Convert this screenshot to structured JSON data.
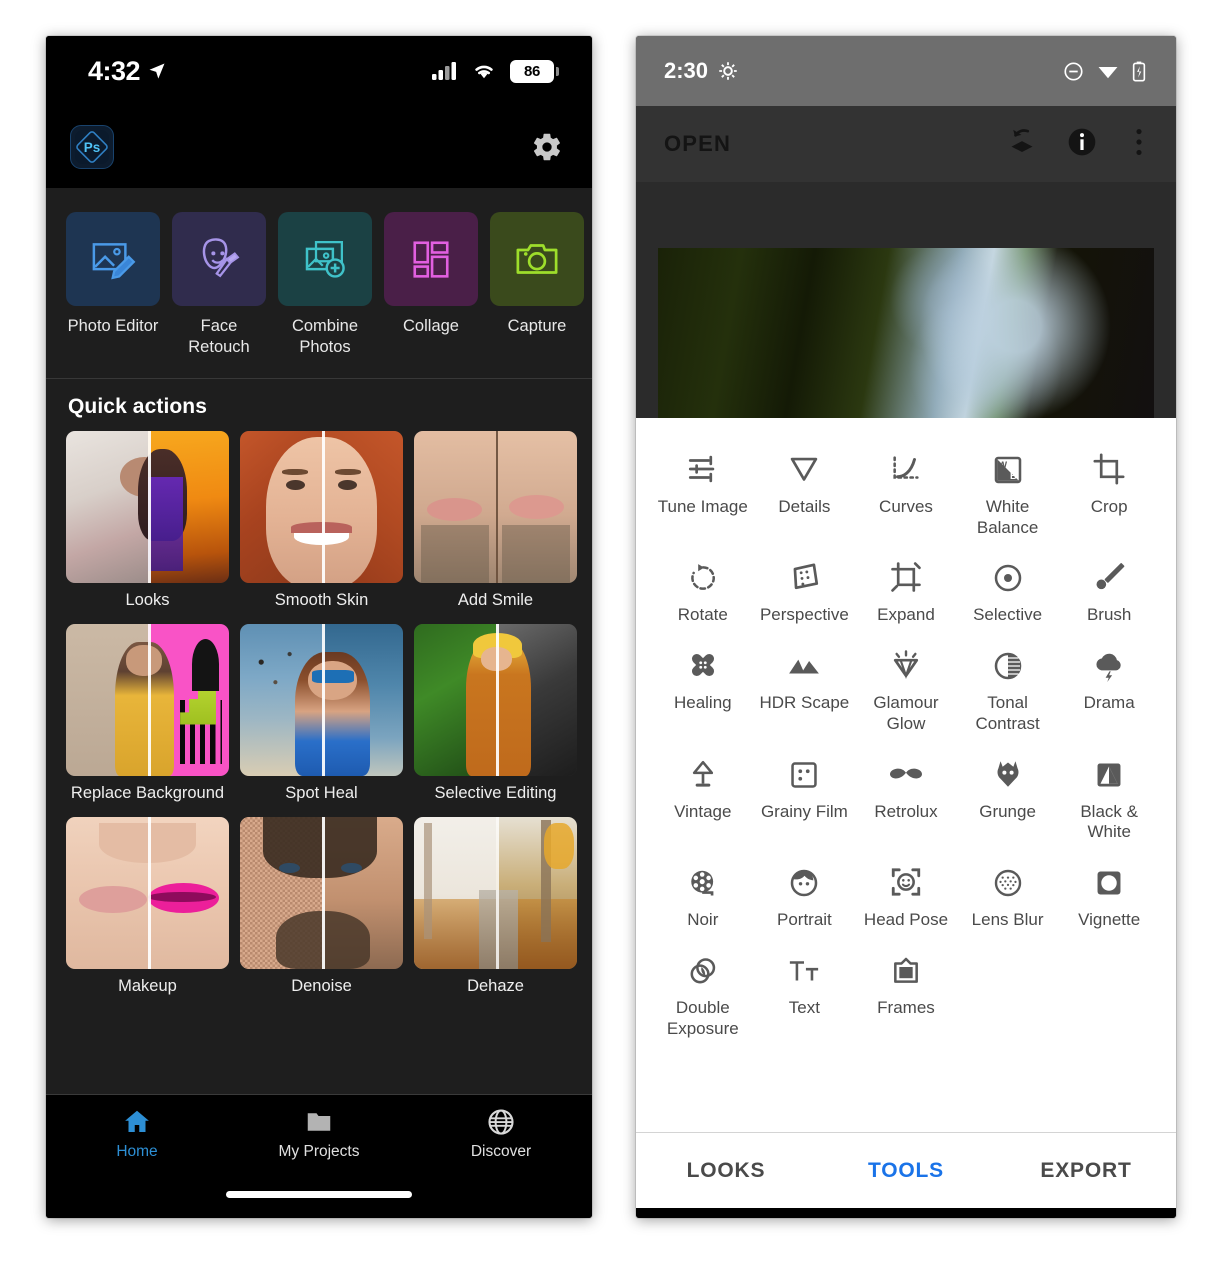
{
  "left_phone": {
    "status_bar": {
      "time": "4:32",
      "location_icon": "location-arrow-icon",
      "cellular_icon": "cellular-signal-icon",
      "wifi_icon": "wifi-icon",
      "battery_level": "86"
    },
    "app_bar": {
      "logo": "photoshop-express-logo",
      "logo_text": "Ps",
      "settings_icon": "gear-icon"
    },
    "tools": [
      {
        "label": "Photo Editor",
        "icon": "photo-edit-icon",
        "bg": "#1e3552",
        "fg": "#4a9ae8"
      },
      {
        "label": "Face Retouch",
        "icon": "face-retouch-icon",
        "bg": "#302c4d",
        "fg": "#a694e8"
      },
      {
        "label": "Combine Photos",
        "icon": "combine-photos-icon",
        "bg": "#1b4144",
        "fg": "#3fc2c9"
      },
      {
        "label": "Collage",
        "icon": "collage-icon",
        "bg": "#4a1f48",
        "fg": "#e25fe0"
      },
      {
        "label": "Capture",
        "icon": "camera-icon",
        "bg": "#3a4a1c",
        "fg": "#9ede2b"
      }
    ],
    "quick_actions_title": "Quick actions",
    "quick_actions": [
      [
        {
          "label": "Looks",
          "thumb": "woman-on-phone-before-after"
        },
        {
          "label": "Smooth Skin",
          "thumb": "redhead-woman-face-before-after"
        },
        {
          "label": "Add Smile",
          "thumb": "man-mouth-before-after"
        }
      ],
      [
        {
          "label": "Replace Background",
          "thumb": "woman-yellow-dress-before-after"
        },
        {
          "label": "Spot Heal",
          "thumb": "beach-selfie-before-after"
        },
        {
          "label": "Selective Editing",
          "thumb": "woman-hat-jungle-before-after"
        }
      ],
      [
        {
          "label": "Makeup",
          "thumb": "lips-before-after"
        },
        {
          "label": "Denoise",
          "thumb": "man-portrait-noise-before-after"
        },
        {
          "label": "Dehaze",
          "thumb": "foggy-forest-path-before-after"
        }
      ]
    ],
    "bottom_nav": {
      "active_color": "#2d8fd5",
      "inactive_color": "#b3b3b3",
      "items": [
        {
          "label": "Home",
          "icon": "home-icon",
          "active": true
        },
        {
          "label": "My Projects",
          "icon": "folder-icon",
          "active": false
        },
        {
          "label": "Discover",
          "icon": "globe-icon",
          "active": false
        }
      ]
    }
  },
  "right_phone": {
    "status_bar": {
      "time": "2:30",
      "gear_icon": "gear-icon",
      "dnd_icon": "do-not-disturb-icon",
      "wifi_icon": "wifi-icon",
      "battery_icon": "battery-charging-icon"
    },
    "app_bar": {
      "title": "OPEN",
      "icons": [
        {
          "name": "undo-layers-icon"
        },
        {
          "name": "info-icon"
        },
        {
          "name": "overflow-menu-icon"
        }
      ]
    },
    "preview": {
      "image": "dark-tree-foliage-photo"
    },
    "tools_grid": [
      [
        {
          "label": "Tune Image",
          "icon": "sliders-icon"
        },
        {
          "label": "Details",
          "icon": "triangle-down-icon"
        },
        {
          "label": "Curves",
          "icon": "curves-icon"
        },
        {
          "label": "White Balance",
          "icon": "white-balance-icon"
        },
        {
          "label": "Crop",
          "icon": "crop-icon"
        }
      ],
      [
        {
          "label": "Rotate",
          "icon": "rotate-icon"
        },
        {
          "label": "Perspective",
          "icon": "perspective-icon"
        },
        {
          "label": "Expand",
          "icon": "expand-icon"
        },
        {
          "label": "Selective",
          "icon": "selective-target-icon"
        },
        {
          "label": "Brush",
          "icon": "brush-icon"
        }
      ],
      [
        {
          "label": "Healing",
          "icon": "healing-bandage-icon"
        },
        {
          "label": "HDR Scape",
          "icon": "mountains-icon"
        },
        {
          "label": "Glamour Glow",
          "icon": "diamond-glow-icon"
        },
        {
          "label": "Tonal Contrast",
          "icon": "contrast-circle-icon"
        },
        {
          "label": "Drama",
          "icon": "storm-cloud-icon"
        }
      ],
      [
        {
          "label": "Vintage",
          "icon": "lamp-icon"
        },
        {
          "label": "Grainy Film",
          "icon": "film-grain-icon"
        },
        {
          "label": "Retrolux",
          "icon": "mustache-icon"
        },
        {
          "label": "Grunge",
          "icon": "grunge-skull-icon"
        },
        {
          "label": "Black & White",
          "icon": "black-white-icon"
        }
      ],
      [
        {
          "label": "Noir",
          "icon": "film-reel-icon"
        },
        {
          "label": "Portrait",
          "icon": "portrait-face-icon"
        },
        {
          "label": "Head Pose",
          "icon": "head-pose-icon"
        },
        {
          "label": "Lens Blur",
          "icon": "lens-blur-icon"
        },
        {
          "label": "Vignette",
          "icon": "vignette-icon"
        }
      ],
      [
        {
          "label": "Double Exposure",
          "icon": "double-exposure-icon"
        },
        {
          "label": "Text",
          "icon": "text-icon"
        },
        {
          "label": "Frames",
          "icon": "frames-icon"
        }
      ]
    ],
    "tabs": [
      {
        "label": "LOOKS",
        "active": false
      },
      {
        "label": "TOOLS",
        "active": true
      },
      {
        "label": "EXPORT",
        "active": false
      }
    ],
    "accent_color": "#1a73e8"
  }
}
